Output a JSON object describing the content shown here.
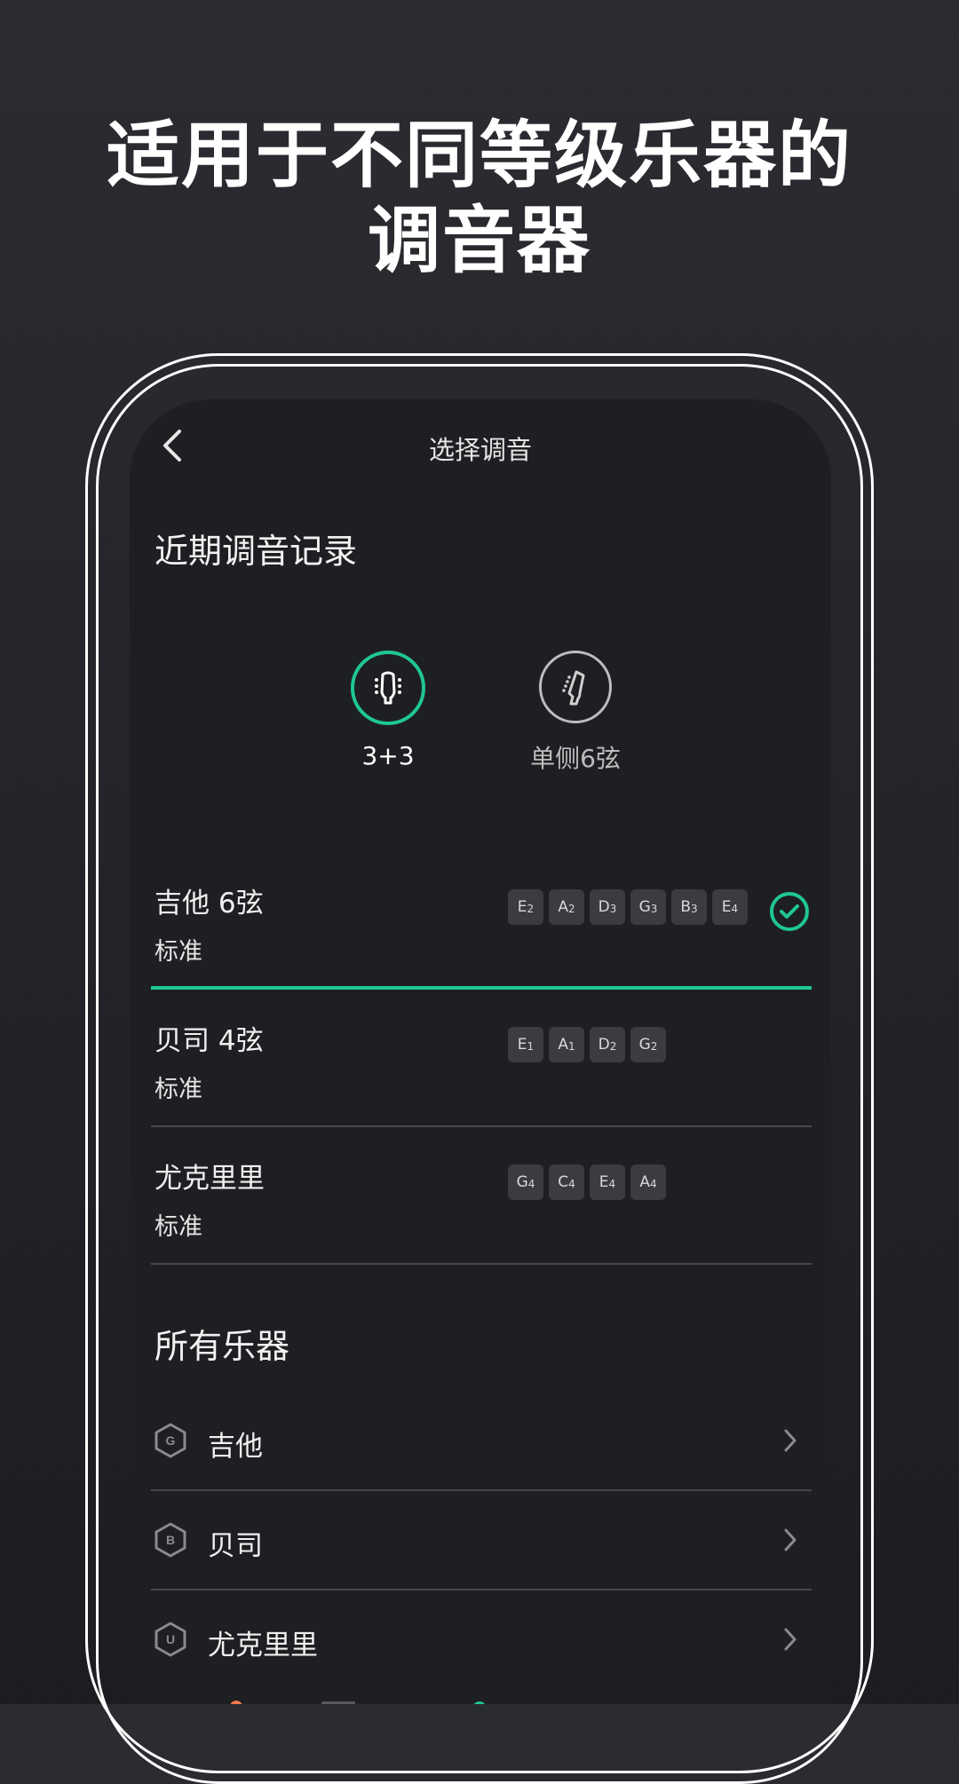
{
  "promo": {
    "headline_line1": "适用于不同等级乐器的",
    "headline_line2": "调音器"
  },
  "header": {
    "title": "选择调音",
    "back_icon": "chevron-left-icon"
  },
  "recent": {
    "title": "近期调音记录",
    "modes": [
      {
        "label": "3+3",
        "icon": "headstock-3x3-icon",
        "selected": true
      },
      {
        "label": "单侧6弦",
        "icon": "headstock-6-inline-icon",
        "selected": false
      }
    ],
    "items": [
      {
        "name": "吉他 6弦",
        "tuning": "标准",
        "notes": [
          "E",
          "A",
          "D",
          "G",
          "B",
          "E"
        ],
        "octaves": [
          "2",
          "2",
          "3",
          "3",
          "3",
          "4"
        ],
        "selected": true
      },
      {
        "name": "贝司 4弦",
        "tuning": "标准",
        "notes": [
          "E",
          "A",
          "D",
          "G"
        ],
        "octaves": [
          "1",
          "1",
          "2",
          "2"
        ],
        "selected": false
      },
      {
        "name": "尤克里里",
        "tuning": "标准",
        "notes": [
          "G",
          "C",
          "E",
          "A"
        ],
        "octaves": [
          "4",
          "4",
          "4",
          "4"
        ],
        "selected": false
      }
    ]
  },
  "all": {
    "title": "所有乐器",
    "items": [
      {
        "badge": "G",
        "label": "吉他"
      },
      {
        "badge": "B",
        "label": "贝司"
      },
      {
        "badge": "U",
        "label": "尤克里里"
      }
    ]
  },
  "colors": {
    "accent": "#1fc795",
    "background": "#1e1f22",
    "chip": "#3b3c40",
    "divider": "#47484c"
  }
}
